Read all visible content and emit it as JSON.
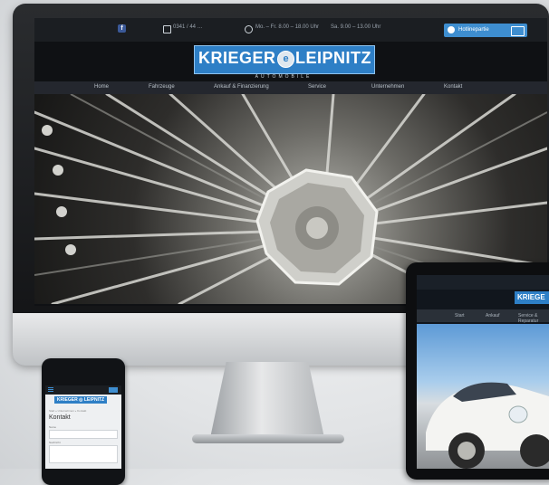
{
  "website": {
    "topbar": {
      "facebook": "f",
      "phone": "0341 / 44 …",
      "hours_weekdays": "Mo. – Fr. 8.00 – 18.00 Uhr",
      "hours_saturday": "Sa. 9.00 – 13.00 Uhr",
      "contact_button": "Hotlinepartie"
    },
    "logo": {
      "left": "KRIEGER",
      "right": "LEIPNITZ",
      "tagline": "AUTOMOBILE"
    },
    "nav": [
      "Home",
      "Fahrzeuge",
      "Ankauf & Finanzierung",
      "Service",
      "Unternehmen",
      "Kontakt"
    ]
  },
  "tablet": {
    "logo": "KRIEGE",
    "nav": [
      "Start",
      "Ankauf",
      "Service & Reparatur"
    ]
  },
  "phone": {
    "logo": "KRIEGER ◎ LEIPNITZ",
    "breadcrumb": "Start » Unternehmen » Kontakt",
    "title": "Kontakt",
    "field_labels": [
      "Name",
      "Nachricht"
    ]
  },
  "colors": {
    "brand": "#2e7fc6",
    "topbar": "#1b1e22",
    "nav": "#2a2e34"
  },
  "icons": [
    "facebook-icon",
    "phone-icon",
    "clock-icon",
    "info-icon",
    "mail-icon",
    "menu-icon"
  ]
}
